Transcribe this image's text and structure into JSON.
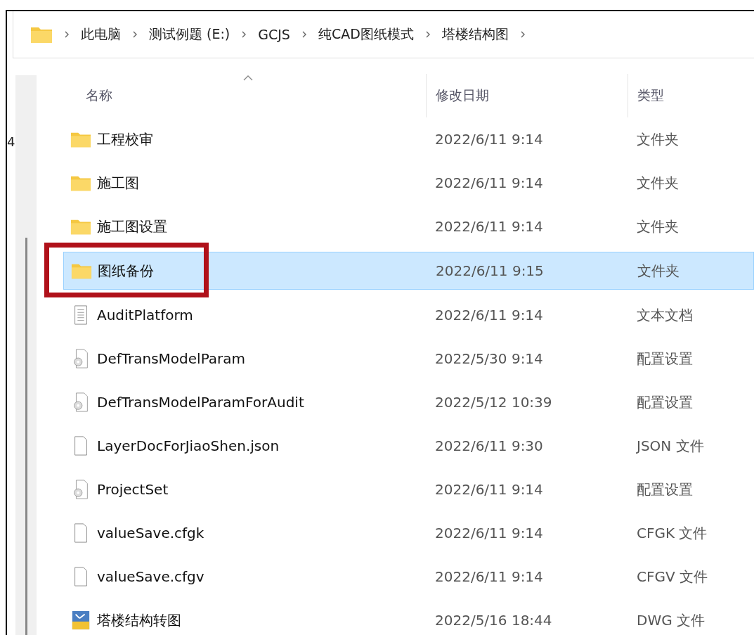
{
  "breadcrumb": [
    "此电脑",
    "测试例题 (E:)",
    "GCJS",
    "纯CAD图纸模式",
    "塔楼结构图"
  ],
  "nav_pane": {
    "fragment": "4"
  },
  "columns": [
    {
      "label": "名称",
      "sorted": true
    },
    {
      "label": "修改日期",
      "sorted": false
    },
    {
      "label": "类型",
      "sorted": false
    }
  ],
  "rows": [
    {
      "kind": "folder",
      "name": "工程校审",
      "date": "2022/6/11 9:14",
      "type": "文件夹",
      "selected": false,
      "marked": false
    },
    {
      "kind": "folder",
      "name": "施工图",
      "date": "2022/6/11 9:14",
      "type": "文件夹",
      "selected": false,
      "marked": false
    },
    {
      "kind": "folder",
      "name": "施工图设置",
      "date": "2022/6/11 9:14",
      "type": "文件夹",
      "selected": false,
      "marked": false
    },
    {
      "kind": "folder",
      "name": "图纸备份",
      "date": "2022/6/11 9:15",
      "type": "文件夹",
      "selected": true,
      "marked": true
    },
    {
      "kind": "text",
      "name": "AuditPlatform",
      "date": "2022/6/11 9:14",
      "type": "文本文档",
      "selected": false,
      "marked": false
    },
    {
      "kind": "config",
      "name": "DefTransModelParam",
      "date": "2022/5/30 9:14",
      "type": "配置设置",
      "selected": false,
      "marked": false
    },
    {
      "kind": "config",
      "name": "DefTransModelParamForAudit",
      "date": "2022/5/12 10:39",
      "type": "配置设置",
      "selected": false,
      "marked": false
    },
    {
      "kind": "file",
      "name": "LayerDocForJiaoShen.json",
      "date": "2022/6/11 9:30",
      "type": "JSON 文件",
      "selected": false,
      "marked": false
    },
    {
      "kind": "config",
      "name": "ProjectSet",
      "date": "2022/6/11 9:14",
      "type": "配置设置",
      "selected": false,
      "marked": false
    },
    {
      "kind": "file",
      "name": "valueSave.cfgk",
      "date": "2022/6/11 9:14",
      "type": "CFGK 文件",
      "selected": false,
      "marked": false
    },
    {
      "kind": "file",
      "name": "valueSave.cfgv",
      "date": "2022/6/11 9:14",
      "type": "CFGV 文件",
      "selected": false,
      "marked": false
    },
    {
      "kind": "dwg",
      "name": "塔楼结构转图",
      "date": "2022/5/16 18:44",
      "type": "DWG 文件",
      "selected": false,
      "marked": false
    }
  ]
}
